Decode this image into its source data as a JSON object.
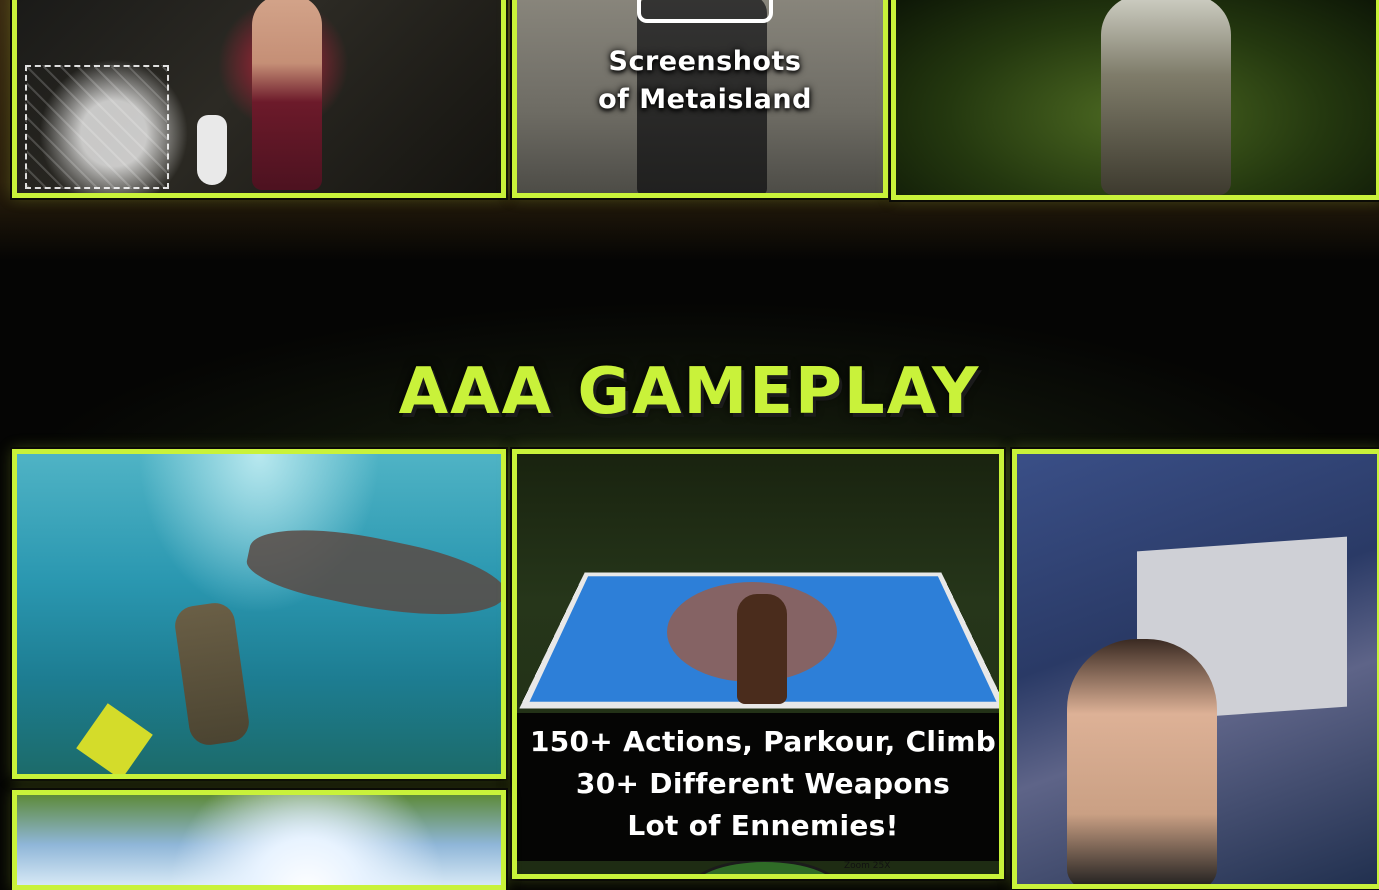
{
  "top_gallery": {
    "screenshots_caption_line1": "Screenshots",
    "screenshots_caption_line2": "of Metaisland"
  },
  "section": {
    "title": "AAA GAMEPLAY"
  },
  "gameplay": {
    "caption_line1": "150+ Actions, Parkour, Climb",
    "caption_line2": "30+ Different Weapons",
    "caption_line3": "Lot of Ennemies!",
    "zoom_label": "Zoom 25X"
  },
  "colors": {
    "accent": "#c9f23a",
    "background": "#050504"
  }
}
